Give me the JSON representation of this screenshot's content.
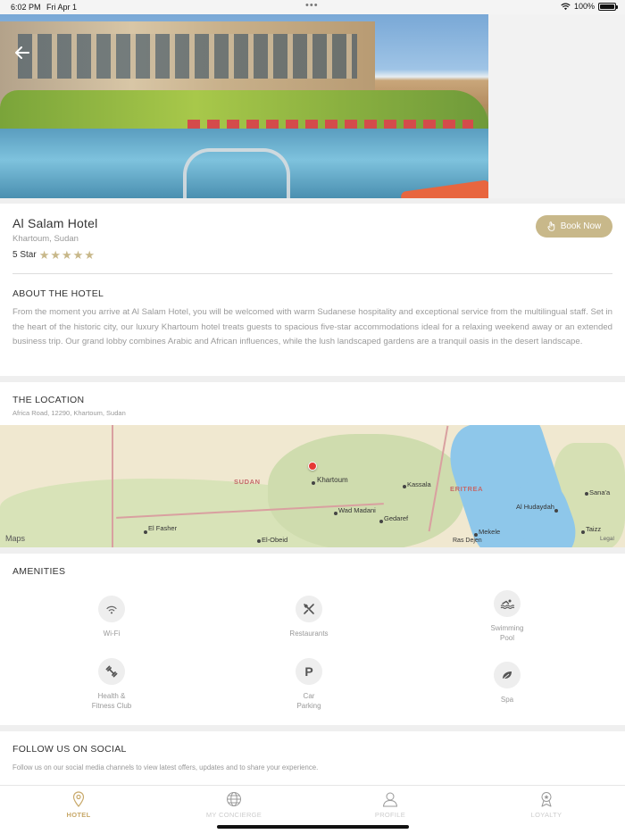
{
  "status_bar": {
    "time": "6:02 PM",
    "date": "Fri Apr 1",
    "battery": "100%"
  },
  "hotel": {
    "name": "Al Salam Hotel",
    "city": "Khartoum, Sudan",
    "star_label": "5 Star",
    "stars": 5,
    "book_label": "Book Now"
  },
  "about": {
    "title": "ABOUT THE HOTEL",
    "text": "From the moment you arrive at Al Salam Hotel, you will be welcomed with warm Sudanese hospitality and exceptional service from the multilingual staff. Set in the heart of the historic city, our luxury Khartoum hotel treats guests to spacious five-star accommodations ideal for a relaxing weekend away or an extended business trip.  Our grand lobby combines Arabic and African influences, while the lush landscaped gardens are a tranquil oasis in the desert landscape."
  },
  "location": {
    "title": "THE LOCATION",
    "address": "Africa Road, 12290, Khartoum, Sudan",
    "map": {
      "country_sudan": "SUDAN",
      "country_eritrea": "ERITREA",
      "khartoum": "Khartoum",
      "kassala": "Kassala",
      "wad_madani": "Wad Madani",
      "gedaref": "Gedaref",
      "el_fasher": "El Fasher",
      "el_obeid": "El-Obeid",
      "mekele": "Mekele",
      "ras_dejen": "Ras Dejen",
      "al_hudaydah": "Al Hudaydah",
      "sanaa": "Sana'a",
      "taizz": "Taizz",
      "maps_logo": "Maps",
      "legal": "Legal"
    }
  },
  "amenities": {
    "title": "AMENITIES",
    "items": [
      {
        "l1": "Wi-Fi",
        "l2": "",
        "icon": "wifi-icon"
      },
      {
        "l1": "Restaurants",
        "l2": "",
        "icon": "restaurant-icon"
      },
      {
        "l1": "Swimming",
        "l2": "Pool",
        "icon": "swimming-icon"
      },
      {
        "l1": "Health &",
        "l2": "Fitness Club",
        "icon": "fitness-icon"
      },
      {
        "l1": "Car",
        "l2": "Parking",
        "icon": "parking-icon"
      },
      {
        "l1": "Spa",
        "l2": "",
        "icon": "spa-icon"
      }
    ]
  },
  "social": {
    "title": "FOLLOW US ON SOCIAL",
    "text": "Follow us on our social media channels to view latest offers, updates and to share your experience."
  },
  "tabs": [
    {
      "label": "HOTEL",
      "icon": "location-pin-icon",
      "active": true
    },
    {
      "label": "MY CONCIERGE",
      "icon": "globe-icon",
      "active": false
    },
    {
      "label": "PROFILE",
      "icon": "user-icon",
      "active": false
    },
    {
      "label": "LOYALTY",
      "icon": "award-icon",
      "active": false
    }
  ],
  "colors": {
    "accent": "#c8b88a",
    "tab_active": "#c8a96a",
    "pin": "#e53935"
  }
}
